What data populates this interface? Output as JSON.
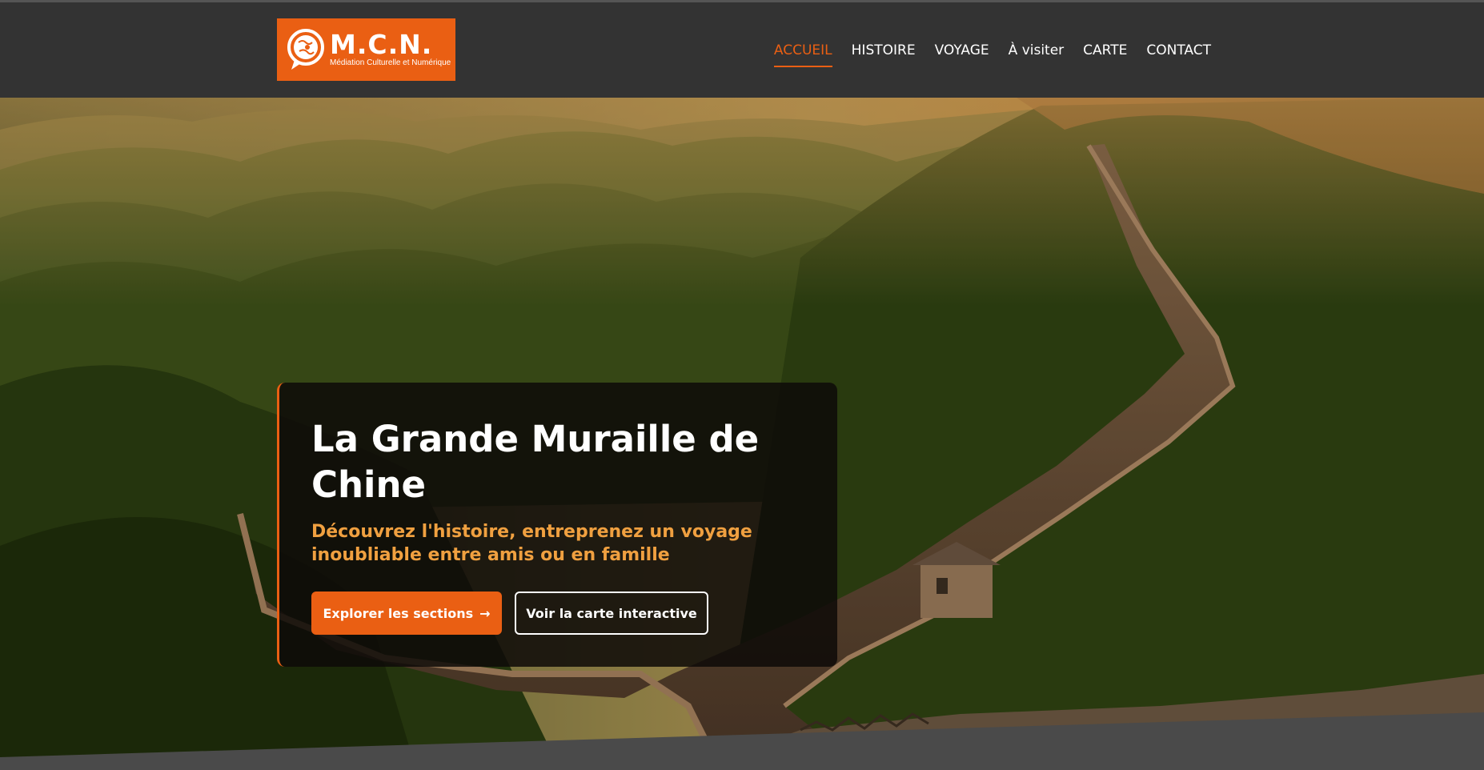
{
  "brand": {
    "name": "M.C.N.",
    "tagline": "Médiation Culturelle et Numérique",
    "icon": "speech-bubble-globe-icon",
    "color": "#ea5f13"
  },
  "nav": {
    "items": [
      {
        "label": "ACCUEIL",
        "active": true
      },
      {
        "label": "HISTOIRE",
        "active": false
      },
      {
        "label": "VOYAGE",
        "active": false
      },
      {
        "label": "À visiter",
        "active": false
      },
      {
        "label": "CARTE",
        "active": false
      },
      {
        "label": "CONTACT",
        "active": false
      }
    ]
  },
  "hero": {
    "title": "La Grande Muraille de Chine",
    "subtitle": "Découvrez l'histoire, entreprenez un voyage inoubliable entre amis ou en famille",
    "primary_button": "Explorer les sections",
    "primary_button_icon": "→",
    "secondary_button": "Voir la carte interactive",
    "background_image": "great-wall-mountains-sunset"
  },
  "colors": {
    "accent": "#ea5f13",
    "subtitle": "#f0a040",
    "header_bg": "#333333"
  }
}
